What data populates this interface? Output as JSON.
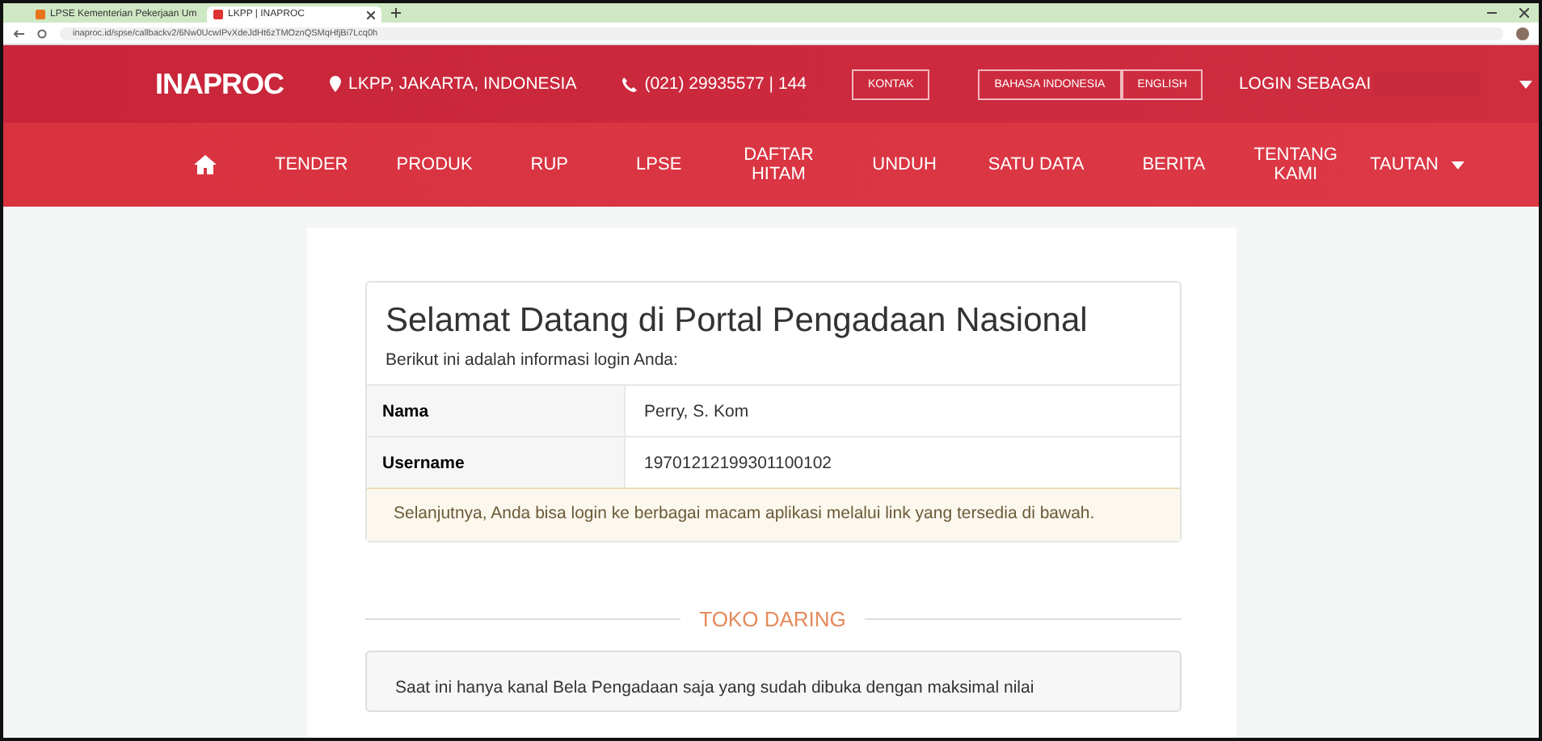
{
  "browser": {
    "tabs": [
      {
        "title": "LPSE Kementerian Pekerjaan Um",
        "selected": false
      },
      {
        "title": "LKPP | INAPROC",
        "selected": true
      }
    ],
    "url": "inaproc.id/spse/callbackv2/6Nw0UcwIPvXdeJdHt6zTMOznQSMqHfjBi7Lcq0h"
  },
  "header": {
    "logo": "INAPROC",
    "location": "LKPP, JAKARTA, INDONESIA",
    "phone": "(021) 29935577 | 144",
    "contact_button": "KONTAK",
    "languages": [
      {
        "label": "BAHASA INDONESIA"
      },
      {
        "label": "ENGLISH"
      }
    ],
    "login_label": "LOGIN SEBAGAI"
  },
  "nav": [
    {
      "label": "TENDER"
    },
    {
      "label": "PRODUK"
    },
    {
      "label": "RUP"
    },
    {
      "label": "LPSE"
    },
    {
      "label": "DAFTAR HITAM"
    },
    {
      "label": "UNDUH"
    },
    {
      "label": "SATU DATA"
    },
    {
      "label": "BERITA"
    },
    {
      "label": "TENTANG KAMI"
    },
    {
      "label": "TAUTAN",
      "dropdown": true
    }
  ],
  "welcome": {
    "title": "Selamat Datang di Portal Pengadaan Nasional",
    "subtitle": "Berikut ini adalah informasi login Anda:",
    "rows": [
      {
        "label": "Nama",
        "value": "Perry, S. Kom"
      },
      {
        "label": "Username",
        "value": "19701212199301100102"
      }
    ],
    "notice": "Selanjutnya, Anda bisa login ke berbagai macam aplikasi melalui link yang tersedia di bawah."
  },
  "section": {
    "title": "TOKO DARING",
    "text": "Saat ini hanya kanal Bela Pengadaan saja yang sudah dibuka dengan maksimal nilai"
  }
}
